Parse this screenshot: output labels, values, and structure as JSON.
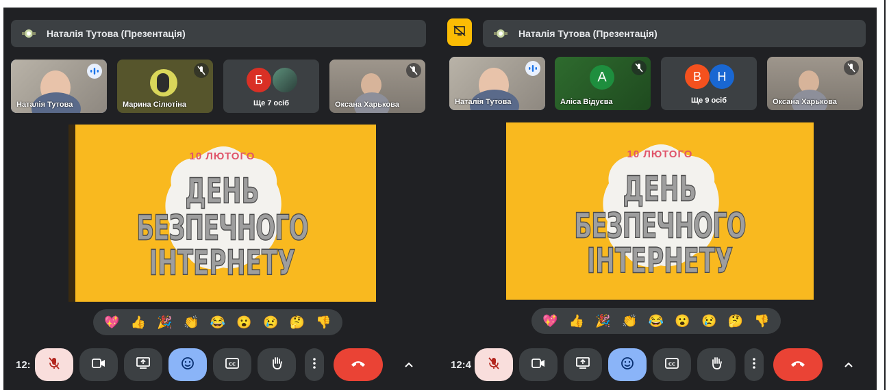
{
  "left": {
    "presenter_title": "Наталія Тутова (Презентація)",
    "tiles": {
      "t1_name": "Наталія Тутова",
      "t2_name": "Марина Сілютіна",
      "t3_avatar_a": "Б",
      "t3_label": "Ще 7 осіб",
      "t4_name": "Оксана Харькова"
    },
    "clock": "12:"
  },
  "right": {
    "presenter_title": "Наталія Тутова (Презентація)",
    "tiles": {
      "t1_name": "Наталія Тутова",
      "t2_avatar": "А",
      "t2_name": "Аліса Відуєва",
      "t3_avatar_a": "В",
      "t3_avatar_b": "Н",
      "t3_label": "Ще 9 осіб",
      "t4_name": "Оксана Харькова"
    },
    "clock": "12:4"
  },
  "slide": {
    "date": "10 ЛЮТОГО",
    "line1": "ДЕНЬ",
    "line2": "БЕЗПЕЧНОГО",
    "line3": "ІНТЕРНЕТУ"
  },
  "reactions": [
    "💖",
    "👍",
    "🎉",
    "👏",
    "😂",
    "😮",
    "😢",
    "🤔",
    "👎"
  ],
  "icons": {
    "presentation": "presentation-icon",
    "hide": "hide-presentation-icon",
    "mic_off": "mic-off-icon",
    "speaking": "speaking-icon",
    "camera": "camera-icon",
    "present": "present-screen-icon",
    "emoji": "emoji-icon",
    "captions": "captions-icon",
    "hand": "raise-hand-icon",
    "more": "more-vert-icon",
    "end": "end-call-icon",
    "chevron": "chevron-up-icon"
  },
  "colors": {
    "meet_bg": "#202124",
    "bar_bg": "#3c4043",
    "slide_bg": "#f9b91f",
    "end_call": "#ea4335",
    "active_blue": "#8ab4f8",
    "mic_off_bg": "#f9dedc"
  }
}
